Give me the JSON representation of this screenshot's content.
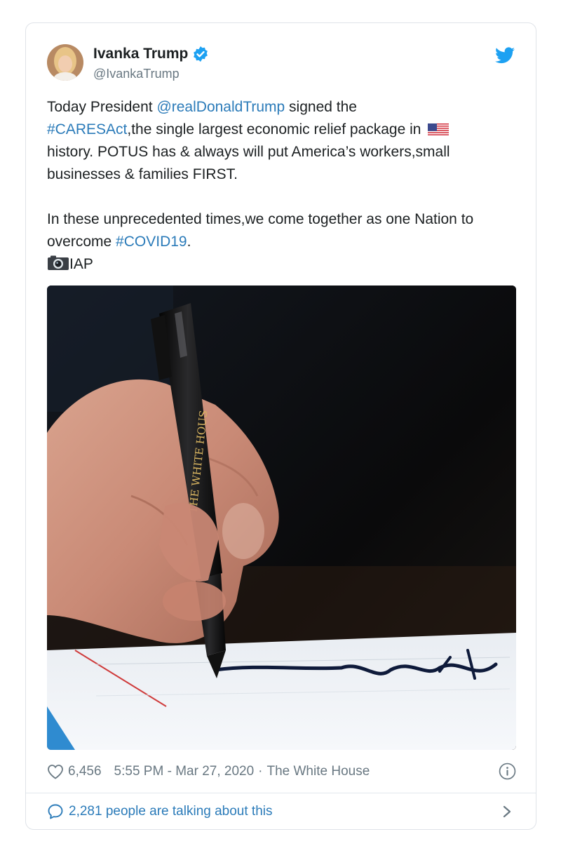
{
  "author": {
    "display_name": "Ivanka Trump",
    "handle": "@IvankaTrump",
    "avatar": "avatar-photo",
    "verified_icon": "verified-badge-icon",
    "platform_icon": "twitter-bird-icon"
  },
  "tweet": {
    "p1_prefix": "Today President ",
    "p1_mention": "@realDonaldTrump",
    "p1_after_mention": " signed the",
    "p1_hashtag": "#CARESAct",
    "p1_rest": ",the single largest economic relief package in ",
    "p1_flag": "us-flag-emoji",
    "p1_line3": "history. POTUS has & always will put America’s workers,small businesses & families FIRST.",
    "p2_text": "In these unprecedented times,we come together as one Nation to overcome ",
    "p2_hashtag": "#COVID19",
    "p2_end": ".",
    "credit_icon": "camera-emoji",
    "credit_text": "IAP"
  },
  "photo": {
    "pen_imprint": "THE WHITE HOUS"
  },
  "footer": {
    "likes": "6,456",
    "timestamp": "5:55 PM - Mar 27, 2020",
    "separator": "·",
    "location": "The White House",
    "heart_icon": "heart-icon",
    "info_icon": "info-icon"
  },
  "conversation": {
    "label": "2,281 people are talking about this",
    "bubble_icon": "reply-bubble-icon",
    "chevron_icon": "chevron-right-icon"
  },
  "colors": {
    "link": "#2b7bb9",
    "text": "#1c2022",
    "muted": "#697882",
    "border": "#dfe3e8",
    "verified": "#1da1f2"
  }
}
